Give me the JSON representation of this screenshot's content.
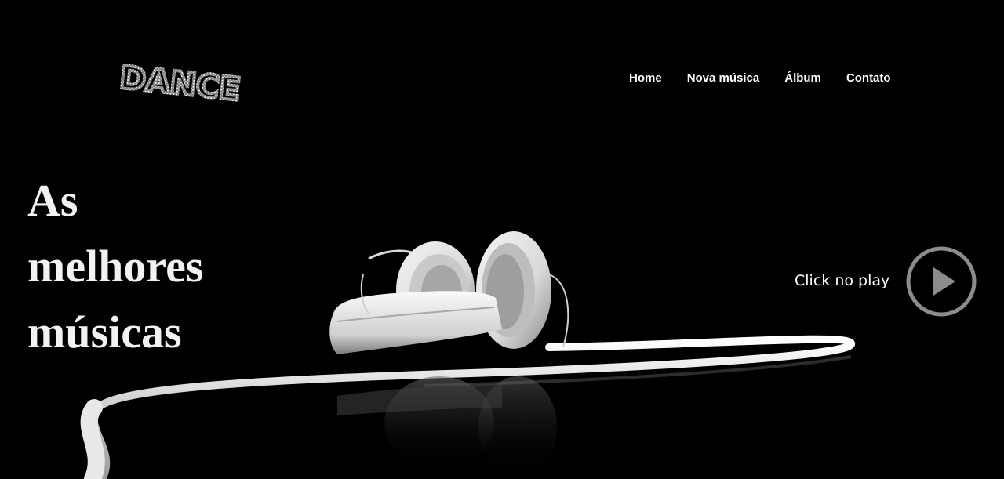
{
  "logo": {
    "text": "DANCE"
  },
  "nav": {
    "home": "Home",
    "nova_musica": "Nova música",
    "album": "Álbum",
    "contato": "Contato"
  },
  "hero": {
    "line1": "As",
    "line2": "melhores",
    "line3": "músicas",
    "play_label": "Click no play",
    "play_icon": "play-icon",
    "image": "headphones-icon"
  },
  "colors": {
    "background": "#000000",
    "text": "#ffffff",
    "play_ring": "#8c8c8c"
  }
}
